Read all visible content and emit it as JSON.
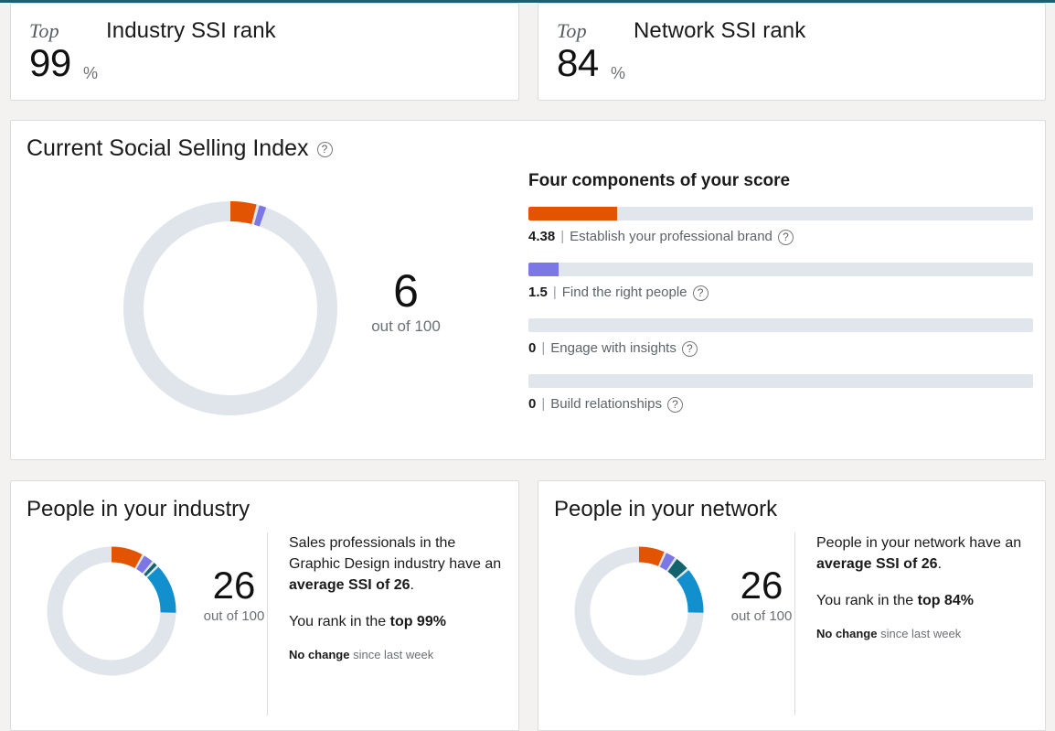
{
  "theme": {
    "page_bg": "#f3f2f1",
    "card_bg": "#ffffff",
    "card_border": "#dcdcdc",
    "top_rule": "#1c5d78",
    "track": "#e1e6ec",
    "orange": "#e25401",
    "purple": "#7b78e5",
    "teal": "#12636b",
    "blue": "#1290cd",
    "donut_track": "#dfe5ea"
  },
  "rank_cards": [
    {
      "id": "industry-rank-card",
      "prefix": "Top",
      "title": "Industry SSI rank",
      "value": "99",
      "unit": "%",
      "help_icon": "question-icon"
    },
    {
      "id": "network-rank-card",
      "prefix": "Top",
      "title": "Network SSI rank",
      "value": "84",
      "unit": "%",
      "help_icon": "question-icon"
    }
  ],
  "ssi": {
    "title": "Current Social Selling Index",
    "help_icon": "question-icon",
    "score": "6",
    "score_suffix": "out of 100",
    "components_title": "Four components of your score",
    "components": [
      {
        "value": "4.38",
        "separator": "|",
        "label": "Establish your professional brand",
        "color": "#e25401",
        "pct": 17.5,
        "help_icon": "question-icon"
      },
      {
        "value": "1.5",
        "separator": "|",
        "label": "Find the right people",
        "color": "#7b78e5",
        "pct": 6.0,
        "help_icon": "question-icon"
      },
      {
        "value": "0",
        "separator": "|",
        "label": "Engage with insights",
        "color": "#12636b",
        "pct": 0,
        "help_icon": "question-icon"
      },
      {
        "value": "0",
        "separator": "|",
        "label": "Build relationships",
        "color": "#1290cd",
        "pct": 0,
        "help_icon": "question-icon"
      }
    ]
  },
  "people_cards": [
    {
      "id": "industry-people-card",
      "title": "People in your industry",
      "score": "26",
      "score_suffix": "out of 100",
      "para1_a": "Sales professionals in the Graphic Design industry have an ",
      "para1_b": "average SSI of 26",
      "para1_c": ".",
      "para2_a": "You rank in the ",
      "para2_b": "top 99%",
      "note_a": "No change",
      "note_b": " since last week"
    },
    {
      "id": "network-people-card",
      "title": "People in your network",
      "score": "26",
      "score_suffix": "out of 100",
      "para1_a": "People in your network have an ",
      "para1_b": "average SSI of 26",
      "para1_c": ".",
      "para2_a": "You rank in the ",
      "para2_b": "top 84%",
      "note_a": "No change",
      "note_b": " since last week"
    }
  ],
  "chart_data": [
    {
      "type": "pie",
      "title": "Current Social Selling Index",
      "chart_id": "ssi-donut",
      "total": 100,
      "unit": "points",
      "center_label": "6",
      "center_sublabel": "out of 100",
      "categories": [
        "Establish your professional brand",
        "Find the right people",
        "Engage with insights",
        "Build relationships",
        "Remaining"
      ],
      "values": [
        4.38,
        1.5,
        0,
        0,
        94.12
      ],
      "colors": [
        "#e25401",
        "#7b78e5",
        "#12636b",
        "#1290cd",
        "#dfe5ea"
      ],
      "legend": "none",
      "notes": "Donut starts at 12 o'clock, clockwise"
    },
    {
      "type": "bar",
      "title": "Four components of your score",
      "chart_id": "components-bars",
      "orientation": "horizontal",
      "categories": [
        "Establish your professional brand",
        "Find the right people",
        "Engage with insights",
        "Build relationships"
      ],
      "values": [
        4.38,
        1.5,
        0,
        0
      ],
      "xlim": [
        0,
        25
      ],
      "colors": [
        "#e25401",
        "#7b78e5",
        "#12636b",
        "#1290cd"
      ],
      "grid": false,
      "legend": "none"
    },
    {
      "type": "pie",
      "title": "People in your industry",
      "chart_id": "industry-donut",
      "total": 100,
      "center_label": "26",
      "center_sublabel": "out of 100",
      "categories": [
        "Establish your professional brand",
        "Find the right people",
        "Engage with insights",
        "Build relationships",
        "Remaining"
      ],
      "values": [
        8.5,
        3.0,
        1.5,
        13.0,
        74.0
      ],
      "colors": [
        "#e25401",
        "#7b78e5",
        "#12636b",
        "#1290cd",
        "#dfe5ea"
      ],
      "legend": "none"
    },
    {
      "type": "pie",
      "title": "People in your network",
      "chart_id": "network-donut",
      "total": 100,
      "center_label": "26",
      "center_sublabel": "out of 100",
      "categories": [
        "Establish your professional brand",
        "Find the right people",
        "Engage with insights",
        "Build relationships",
        "Remaining"
      ],
      "values": [
        7.0,
        3.0,
        4.0,
        12.0,
        74.0
      ],
      "colors": [
        "#e25401",
        "#7b78e5",
        "#12636b",
        "#1290cd",
        "#dfe5ea"
      ],
      "legend": "none"
    }
  ]
}
